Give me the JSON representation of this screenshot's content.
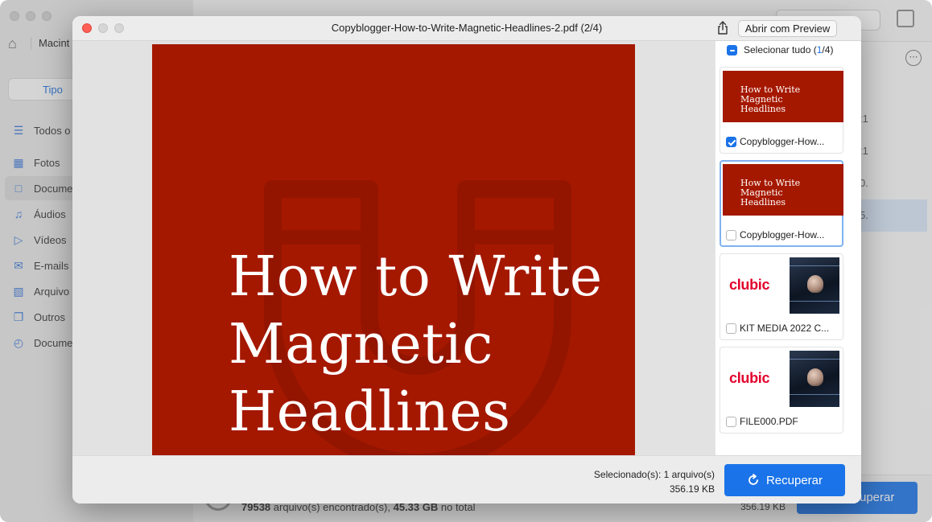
{
  "background": {
    "drive_label": "Macint",
    "tab_label": "Tipo",
    "sidebar_items": [
      {
        "label": "Todos o",
        "icon": "list-icon"
      },
      {
        "label": "Fotos",
        "icon": "photo-icon"
      },
      {
        "label": "Docume",
        "icon": "document-icon"
      },
      {
        "label": "Áudios",
        "icon": "music-icon"
      },
      {
        "label": "Vídeos",
        "icon": "video-icon"
      },
      {
        "label": "E-mails",
        "icon": "mail-icon"
      },
      {
        "label": "Arquivo",
        "icon": "archive-icon"
      },
      {
        "label": "Outros",
        "icon": "copy-icon"
      },
      {
        "label": "Docume",
        "icon": "clock-document-icon"
      }
    ],
    "column_fragments": [
      ":1",
      ":1",
      "0.",
      "5."
    ],
    "footer": {
      "found_count": "79538",
      "found_text": " arquivo(s) encontrado(s), ",
      "found_size": "45.33 GB",
      "total_text": " no total",
      "size": "356.19 KB",
      "recover_label": "uperar"
    }
  },
  "modal": {
    "title": "Copyblogger-How-to-Write-Magnetic-Headlines-2.pdf (2/4)",
    "open_preview_label": "Abrir com Preview",
    "document": {
      "headline_lines": [
        "How to Write",
        "Magnetic",
        "Headlines"
      ],
      "accent_color": "#a51800"
    },
    "select_all": {
      "label": "Selecionar tudo",
      "selected": "1",
      "total": "4"
    },
    "files": [
      {
        "name": "Copyblogger-How...",
        "checked": true,
        "selected": false,
        "thumb": "red",
        "thumb_text": [
          "How to Write",
          "Magnetic",
          "Headlines"
        ]
      },
      {
        "name": "Copyblogger-How...",
        "checked": false,
        "selected": true,
        "thumb": "red",
        "thumb_text": [
          "How to Write",
          "Magnetic",
          "Headlines"
        ]
      },
      {
        "name": "KIT MEDIA 2022 C...",
        "checked": false,
        "selected": false,
        "thumb": "clubic",
        "thumb_text": [
          "clubic"
        ]
      },
      {
        "name": "FILE000.PDF",
        "checked": false,
        "selected": false,
        "thumb": "clubic",
        "thumb_text": [
          "clubic"
        ]
      }
    ],
    "footer": {
      "selected_text": "Selecionado(s): 1 arquivo(s)",
      "selected_size": "356.19 KB",
      "recover_label": "Recuperar"
    }
  }
}
